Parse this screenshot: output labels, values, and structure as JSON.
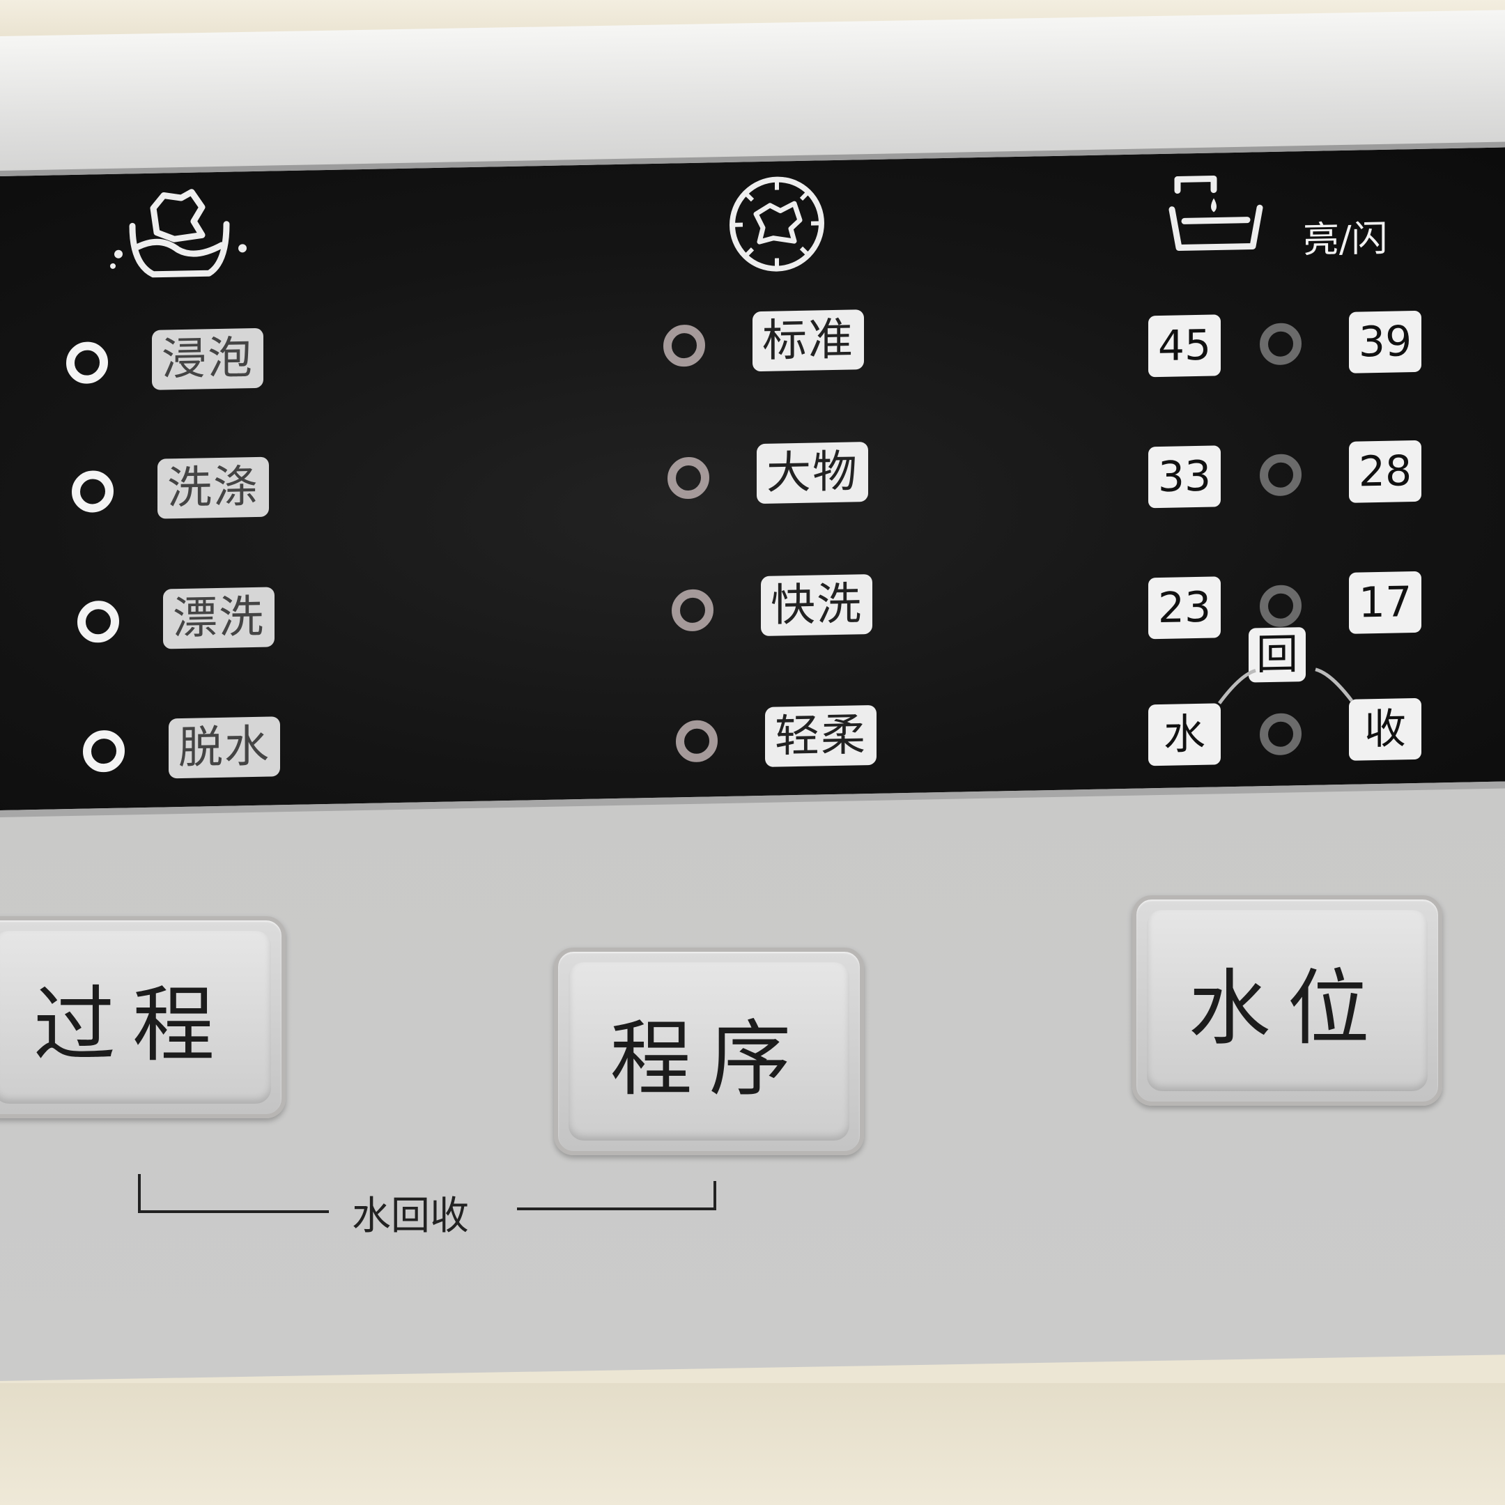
{
  "stages": [
    {
      "label": "浸泡",
      "led": "on"
    },
    {
      "label": "洗涤",
      "led": "on"
    },
    {
      "label": "漂洗",
      "led": "on"
    },
    {
      "label": "脱水",
      "led": "on"
    }
  ],
  "programs": [
    {
      "label": "标准",
      "led": "mid"
    },
    {
      "label": "大物",
      "led": "mid"
    },
    {
      "label": "快洗",
      "led": "mid"
    },
    {
      "label": "轻柔",
      "led": "mid"
    }
  ],
  "water_level": {
    "note": "亮/闪",
    "rows": [
      {
        "left": "45",
        "right": "39"
      },
      {
        "left": "33",
        "right": "28"
      },
      {
        "left": "23",
        "right": "17"
      },
      {
        "left": "水",
        "right": "收",
        "top": "回"
      }
    ]
  },
  "icons": {
    "stage": "soaking-clothes-icon",
    "program": "wash-drum-icon",
    "water": "water-tub-icon"
  },
  "buttons": {
    "process": "过程",
    "program": "程序",
    "water_level": "水位"
  },
  "combo_label": "水回收",
  "colors": {
    "display_bg": "#141414",
    "label_bg": "#ededed",
    "panel": "#c9c9c8"
  }
}
